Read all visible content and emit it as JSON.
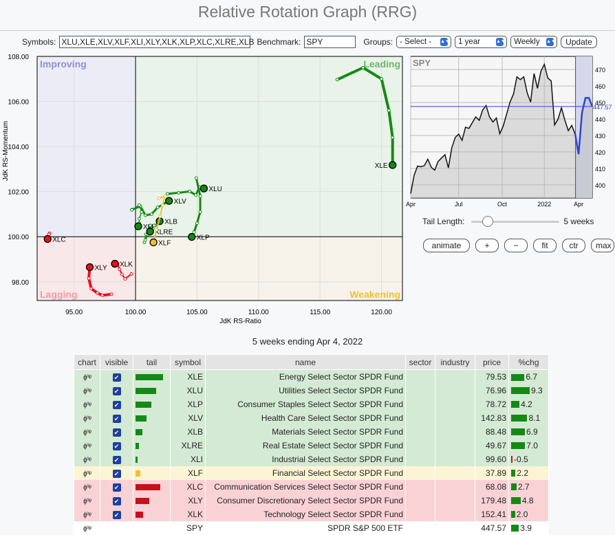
{
  "title": "Relative Rotation Graph (RRG)",
  "controls": {
    "symbols_label": "Symbols:",
    "symbols_value": "XLU,XLE,XLV,XLF,XLI,XLY,XLK,XLP,XLC,XLRE,XLB",
    "benchmark_label": "Benchmark:",
    "benchmark_value": "SPY",
    "groups_label": "Groups:",
    "groups_value": "- Select -",
    "period_value": "1 year",
    "frequency_value": "Weekly",
    "update_label": "Update"
  },
  "colors": {
    "green": "#148a14",
    "yellow": "#f0c030",
    "red": "#e8101c",
    "blue": "#3344cc"
  },
  "chart_data": [
    {
      "type": "scatter",
      "title": "RRG",
      "xlabel": "JdK RS-Ratio",
      "ylabel": "JdK RS-Momentum",
      "xlim": [
        92,
        121.7
      ],
      "ylim": [
        97.17,
        108
      ],
      "xticks": [
        95,
        100,
        105,
        110,
        115,
        120
      ],
      "xtick_labels": [
        "95.00",
        "100.00",
        "105.00",
        "110.00",
        "115.00",
        "120.00"
      ],
      "yticks": [
        98,
        100,
        102,
        104,
        106,
        108
      ],
      "ytick_labels": [
        "98.00",
        "100.00",
        "102.00",
        "104.00",
        "106.00",
        "108.00"
      ],
      "quadrants": {
        "improving": "Improving",
        "leading": "Leading",
        "weakening": "Weakening",
        "lagging": "Lagging"
      },
      "series": [
        {
          "name": "XLE",
          "color": "green",
          "w": 4,
          "points": [
            [
              116.4,
              106.97
            ],
            [
              118.5,
              107.5
            ],
            [
              120.0,
              107.0
            ],
            [
              120.6,
              105.6
            ],
            [
              120.9,
              104.4
            ],
            [
              120.9,
              103.18
            ]
          ]
        },
        {
          "name": "XLU",
          "color": "green",
          "w": 3,
          "points": [
            [
              102.6,
              101.9
            ],
            [
              103.5,
              101.95
            ],
            [
              104.4,
              102.01
            ],
            [
              104.9,
              101.85
            ],
            [
              105.2,
              102.2
            ],
            [
              105.56,
              102.14
            ]
          ]
        },
        {
          "name": "XLP",
          "color": "green",
          "w": 3,
          "points": [
            [
              104.94,
              102.6
            ],
            [
              105.26,
              101.8
            ],
            [
              105.26,
              101.1
            ],
            [
              105.0,
              100.6
            ],
            [
              104.75,
              100.2
            ],
            [
              104.57,
              99.99
            ]
          ]
        },
        {
          "name": "XLV",
          "color": "green",
          "w": 3,
          "points": [
            [
              99.7,
              101.2
            ],
            [
              100.4,
              101.35
            ],
            [
              100.8,
              100.95
            ],
            [
              101.3,
              101.0
            ],
            [
              101.8,
              101.3
            ],
            [
              102.72,
              101.59
            ]
          ]
        },
        {
          "name": "XLB",
          "color": "green",
          "w": 2,
          "points": [
            [
              100.72,
              99.75
            ],
            [
              100.85,
              100.1
            ],
            [
              101.18,
              100.46
            ],
            [
              101.6,
              100.5
            ],
            [
              101.96,
              100.69
            ]
          ]
        },
        {
          "name": "XLRE",
          "color": "green",
          "w": 2,
          "points": [
            [
              100.8,
              99.85
            ],
            [
              101.0,
              100.1
            ],
            [
              101.2,
              100.5
            ],
            [
              101.5,
              100.5
            ],
            [
              101.4,
              100.35
            ],
            [
              101.18,
              100.23
            ]
          ]
        },
        {
          "name": "XLI",
          "color": "green",
          "w": 1.5,
          "points": [
            [
              99.7,
              101.19
            ],
            [
              100.3,
              101.4
            ],
            [
              100.5,
              101.1
            ],
            [
              100.3,
              100.8
            ],
            [
              100.3,
              100.6
            ],
            [
              100.22,
              100.46
            ]
          ]
        },
        {
          "name": "XLF",
          "color": "yellow",
          "w": 2,
          "points": [
            [
              101.9,
              101.7
            ],
            [
              102.4,
              101.8
            ],
            [
              102.2,
              101.4
            ],
            [
              102.0,
              100.9
            ],
            [
              101.7,
              100.3
            ],
            [
              101.46,
              99.75
            ]
          ]
        },
        {
          "name": "XLC",
          "color": "red",
          "w": 3,
          "points": [
            [
              93.0,
              100.15
            ],
            [
              92.95,
              100.1
            ],
            [
              92.9,
              100.0
            ],
            [
              92.85,
              99.9
            ]
          ]
        },
        {
          "name": "XLY",
          "color": "red",
          "w": 4,
          "points": [
            [
              98.04,
              97.45
            ],
            [
              97.3,
              97.4
            ],
            [
              96.9,
              97.5
            ],
            [
              96.4,
              97.7
            ],
            [
              96.2,
              98.15
            ],
            [
              96.28,
              98.65
            ]
          ]
        },
        {
          "name": "XLK",
          "color": "red",
          "w": 2,
          "points": [
            [
              99.67,
              98.35
            ],
            [
              99.15,
              98.13
            ],
            [
              98.9,
              98.33
            ],
            [
              98.7,
              98.55
            ],
            [
              98.55,
              98.8
            ],
            [
              98.32,
              98.8
            ]
          ]
        }
      ]
    },
    {
      "type": "line",
      "title": "SPY",
      "ylim": [
        392,
        478
      ],
      "yticks": [
        400,
        410,
        420,
        430,
        440,
        450,
        460,
        470
      ],
      "xticks": [
        0,
        14,
        26.7,
        39,
        49
      ],
      "xtick_labels": [
        "Apr",
        "Jul",
        "Oct",
        "2022",
        "Apr"
      ],
      "highlight_from": 48.1,
      "last_value": "447.57",
      "values": [
        394.7,
        405.8,
        411.4,
        411,
        411.7,
        415.6,
        410.7,
        408.9,
        414.2,
        416.3,
        418.3,
        410.3,
        422.5,
        428.8,
        430.8,
        427,
        435,
        434.3,
        437.8,
        441.3,
        439.2,
        445.4,
        448.2,
        441.3,
        438.2,
        440.6,
        431.1,
        435.7,
        443,
        450.3,
        455.1,
        465.6,
        463.9,
        465.6,
        455.8,
        450.3,
        467.6,
        458.6,
        469,
        473.2,
        464.9,
        463.1,
        436.4,
        439.9,
        446.8,
        439.2,
        432.9,
        436.1,
        430.8,
        418.6,
        444,
        452.8,
        452.8,
        447.57
      ]
    }
  ],
  "tail": {
    "label": "Tail Length:",
    "value": "5 weeks",
    "fraction": 0.14
  },
  "buttons": [
    "animate",
    "+",
    "−",
    "fit",
    "ctr",
    "max"
  ],
  "caption": "5 weeks ending Apr 4, 2022",
  "table": {
    "headers": [
      "chart",
      "visible",
      "tail",
      "symbol",
      "name",
      "sector",
      "industry",
      "price",
      "%chg"
    ],
    "rows": [
      {
        "color": "green",
        "tail": 40,
        "symbol": "XLE",
        "name": "Energy Select Sector SPDR Fund",
        "price": "79.53",
        "chg": "6.7",
        "visible": true
      },
      {
        "color": "green",
        "tail": 30,
        "symbol": "XLU",
        "name": "Utilities Select Sector SPDR Fund",
        "price": "76.96",
        "chg": "9.3",
        "visible": true
      },
      {
        "color": "green",
        "tail": 23,
        "symbol": "XLP",
        "name": "Consumer Staples Select Sector SPDR Fund",
        "price": "78.72",
        "chg": "4.2",
        "visible": true
      },
      {
        "color": "green",
        "tail": 16,
        "symbol": "XLV",
        "name": "Health Care Select Sector SPDR Fund",
        "price": "142.83",
        "chg": "8.1",
        "visible": true
      },
      {
        "color": "green",
        "tail": 10,
        "symbol": "XLB",
        "name": "Materials Select Sector SPDR Fund",
        "price": "88.48",
        "chg": "6.9",
        "visible": true
      },
      {
        "color": "green",
        "tail": 5,
        "symbol": "XLRE",
        "name": "Real Estate Select Sector SPDR Fund",
        "price": "49.67",
        "chg": "7.0",
        "visible": true
      },
      {
        "color": "green",
        "tail": 3,
        "symbol": "XLI",
        "name": "Industrial Select Sector SPDR Fund",
        "price": "99.60",
        "chg": "-0.5",
        "visible": true
      },
      {
        "color": "yellow",
        "tail": 7,
        "symbol": "XLF",
        "name": "Financial Select Sector SPDR Fund",
        "price": "37.89",
        "chg": "2.2",
        "visible": true
      },
      {
        "color": "red",
        "tail": 36,
        "symbol": "XLC",
        "name": "Communication Services Select Sector SPDR Fund",
        "price": "68.08",
        "chg": "2.7",
        "visible": true
      },
      {
        "color": "red",
        "tail": 20,
        "symbol": "XLY",
        "name": "Consumer Discretionary Select Sector SPDR Fund",
        "price": "179.48",
        "chg": "4.8",
        "visible": true
      },
      {
        "color": "red",
        "tail": 11,
        "symbol": "XLK",
        "name": "Technology Select Sector SPDR Fund",
        "price": "152.41",
        "chg": "2.0",
        "visible": true
      },
      {
        "color": "white",
        "tail": 0,
        "symbol": "SPY",
        "name": "SPDR S&P 500 ETF",
        "price": "447.57",
        "chg": "3.9",
        "visible": false
      }
    ]
  }
}
